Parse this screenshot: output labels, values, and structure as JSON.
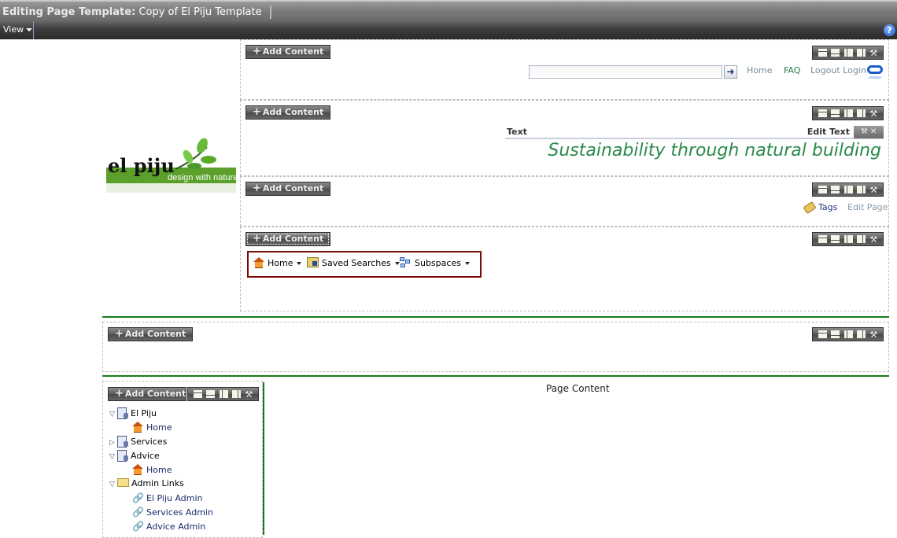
{
  "titlebar": {
    "prefix": "Editing Page Template:",
    "title": "Copy of El Piju Template"
  },
  "menubar": {
    "view_label": "View",
    "help_label": "?"
  },
  "add_content_label": "Add Content",
  "layout_tools": [
    "one-column-icon",
    "two-row-icon",
    "left-column-icon",
    "right-column-icon",
    "wrench-icon"
  ],
  "header": {
    "search_placeholder": "",
    "search_value": "",
    "go_label": "➜",
    "links": [
      {
        "label": "Home",
        "color": "#7a8a9a"
      },
      {
        "label": "FAQ",
        "color": "#2a7a4a"
      },
      {
        "label": "Logout Login",
        "color": "#7a8a9a"
      }
    ]
  },
  "logo": {
    "main_text": "el piju",
    "tagline": "design with nature"
  },
  "text_portlet": {
    "label": "Text",
    "edit_label": "Edit Text",
    "tools": "⚒ ✕",
    "slogan": "Sustainability through natural building"
  },
  "tags_row": {
    "tags_label": "Tags",
    "edit_page_label": "Edit Page"
  },
  "nav": {
    "items": [
      {
        "label": "Home",
        "icon": "home-icon"
      },
      {
        "label": "Saved Searches",
        "icon": "saved-searches-icon"
      },
      {
        "label": "Subspaces",
        "icon": "subspaces-icon"
      }
    ]
  },
  "page_content_label": "Page Content",
  "tree": {
    "nodes": [
      {
        "label": "El Piju",
        "expander": "▽",
        "icon": "space-icon",
        "level": 0
      },
      {
        "label": "Home",
        "expander": "",
        "icon": "home-icon",
        "level": 1
      },
      {
        "label": "Services",
        "expander": "▷",
        "icon": "space-icon",
        "level": 0
      },
      {
        "label": "Advice",
        "expander": "▽",
        "icon": "space-icon",
        "level": 0
      },
      {
        "label": "Home",
        "expander": "",
        "icon": "home-icon",
        "level": 1
      },
      {
        "label": "Admin Links",
        "expander": "▽",
        "icon": "folder-icon",
        "level": 0
      },
      {
        "label": "El Piju Admin",
        "expander": "",
        "icon": "link-icon",
        "level": 1
      },
      {
        "label": "Services Admin",
        "expander": "",
        "icon": "link-icon",
        "level": 1
      },
      {
        "label": "Advice Admin",
        "expander": "",
        "icon": "link-icon",
        "level": 1
      }
    ]
  },
  "colors": {
    "accent_green": "#1a7a1a",
    "slogan_green": "#2a8a4a",
    "nav_border": "#7a0a0a",
    "link_blue": "#1a2a6a"
  }
}
